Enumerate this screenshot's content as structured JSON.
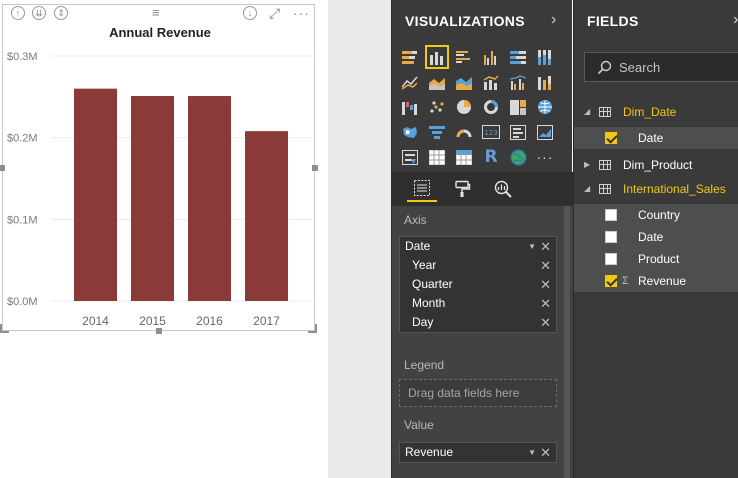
{
  "visual": {
    "header_icons": [
      "drill-up-icon",
      "drill-down-all-icon",
      "expand-hierarchy-icon",
      "drag-grip-icon",
      "drill-mode-icon",
      "focus-mode-icon",
      "more-options-icon"
    ]
  },
  "chart_data": {
    "type": "bar",
    "title": "Annual Revenue",
    "categories": [
      "2014",
      "2015",
      "2016",
      "2017"
    ],
    "series": [
      {
        "values": [
          0.26,
          0.251,
          0.251,
          0.208
        ]
      }
    ],
    "unit": "M",
    "yticks": [
      "$0.0M",
      "$0.1M",
      "$0.2M",
      "$0.3M"
    ],
    "ylim": [
      0,
      0.3
    ],
    "bar_color": "#8b3a3a",
    "grid": true,
    "xlabel": "",
    "ylabel": ""
  },
  "viz_pane": {
    "title": "VISUALIZATIONS",
    "chevron": "›",
    "tabs": [
      "fields-tab-icon",
      "format-tab-icon",
      "analytics-tab-icon"
    ],
    "wells": {
      "axis": {
        "label": "Axis",
        "main": "Date",
        "children": [
          "Year",
          "Quarter",
          "Month",
          "Day"
        ]
      },
      "legend": {
        "label": "Legend",
        "placeholder": "Drag data fields here"
      },
      "value": {
        "label": "Value",
        "main": "Revenue"
      }
    }
  },
  "fields_pane": {
    "title": "FIELDS",
    "search_placeholder": "Search",
    "tables": [
      {
        "name": "Dim_Date",
        "expanded": true,
        "fields": [
          {
            "name": "Date",
            "checked": true
          }
        ]
      },
      {
        "name": "Dim_Product",
        "expanded": false,
        "fields": []
      },
      {
        "name": "International_Sales",
        "expanded": true,
        "fields": [
          {
            "name": "Country",
            "checked": false
          },
          {
            "name": "Date",
            "checked": false
          },
          {
            "name": "Product",
            "checked": false
          },
          {
            "name": "Revenue",
            "checked": true,
            "sigma": true
          }
        ]
      }
    ]
  },
  "colors": {
    "accent": "#f2c811",
    "pane_bg": "#3a3a3a",
    "bar": "#8b3a3a"
  }
}
